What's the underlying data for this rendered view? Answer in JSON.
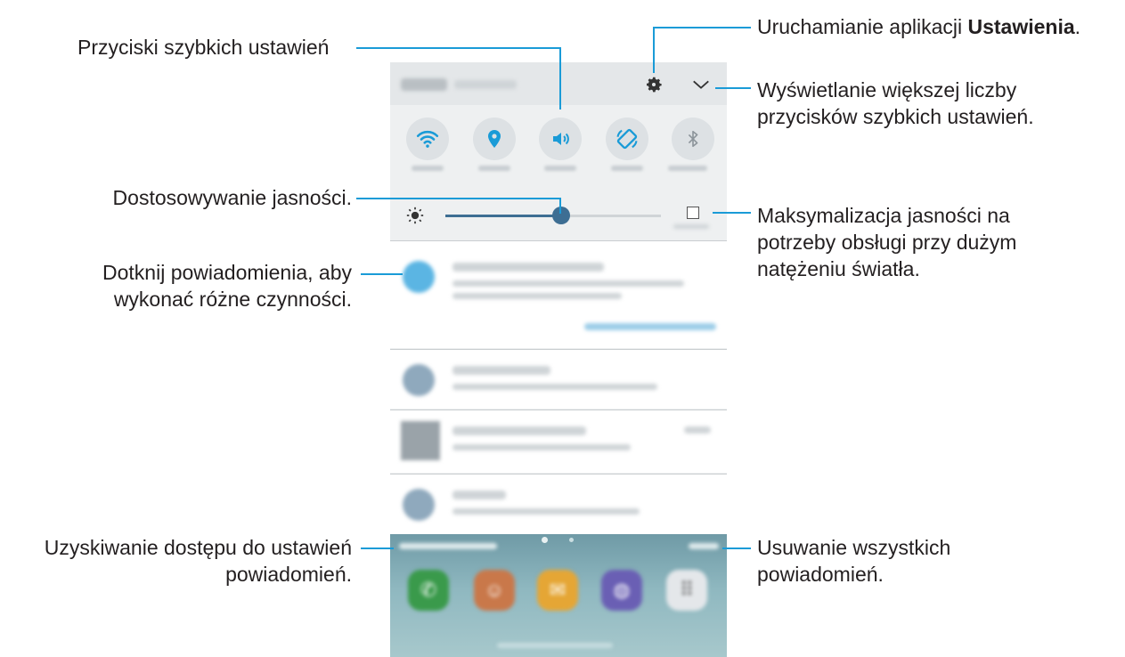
{
  "callouts": {
    "quick_settings_buttons": "Przyciski szybkich ustawień",
    "settings_app_prefix": "Uruchamianie aplikacji ",
    "settings_app_bold": "Ustawienia",
    "settings_app_suffix": ".",
    "more_buttons_line1": "Wyświetlanie większej liczby",
    "more_buttons_line2": "przycisków szybkich ustawień.",
    "adjust_brightness": "Dostosowywanie jasności.",
    "max_brightness_line1": "Maksymalizacja jasności na",
    "max_brightness_line2": "potrzeby obsługi przy dużym",
    "max_brightness_line3": "natężeniu światła.",
    "tap_notification_line1": "Dotknij powiadomienia, aby",
    "tap_notification_line2": "wykonać różne czynności.",
    "notification_settings_line1": "Uzyskiwanie dostępu do ustawień",
    "notification_settings_line2": "powiadomień.",
    "clear_all_line1": "Usuwanie wszystkich",
    "clear_all_line2": "powiadomień."
  },
  "phone": {
    "quick_settings": [
      "wifi-icon",
      "location-icon",
      "sound-icon",
      "auto-rotate-icon",
      "bluetooth-icon"
    ],
    "brightness_level": 0.53,
    "colors": {
      "leader_line": "#1a9bd7",
      "accent": "#1a9bd7",
      "slider": "#3d6e93"
    }
  }
}
